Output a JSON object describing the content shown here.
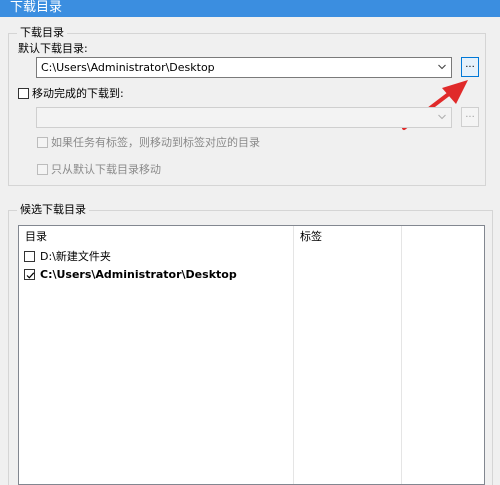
{
  "header": {
    "title": "下载目录"
  },
  "download_group": {
    "title": "下载目录",
    "default_label": "默认下载目录:",
    "default_path": "C:\\Users\\Administrator\\Desktop",
    "browse_label": "...",
    "move_label": "移动完成的下载到:",
    "move_path": "",
    "move_by_tag_label": "如果任务有标签，则移动到标签对应的目录",
    "only_default_label": "只从默认下载目录移动"
  },
  "candidate_group": {
    "title": "候选下载目录",
    "columns": [
      "目录",
      "标签"
    ],
    "rows": [
      {
        "path": "D:\\新建文件夹",
        "tag": "",
        "checked": false
      },
      {
        "path": "C:\\Users\\Administrator\\Desktop",
        "tag": "",
        "checked": true
      }
    ]
  },
  "colors": {
    "accent": "#0078d7",
    "header": "#3b8ee0",
    "arrow": "#e02a2a"
  }
}
